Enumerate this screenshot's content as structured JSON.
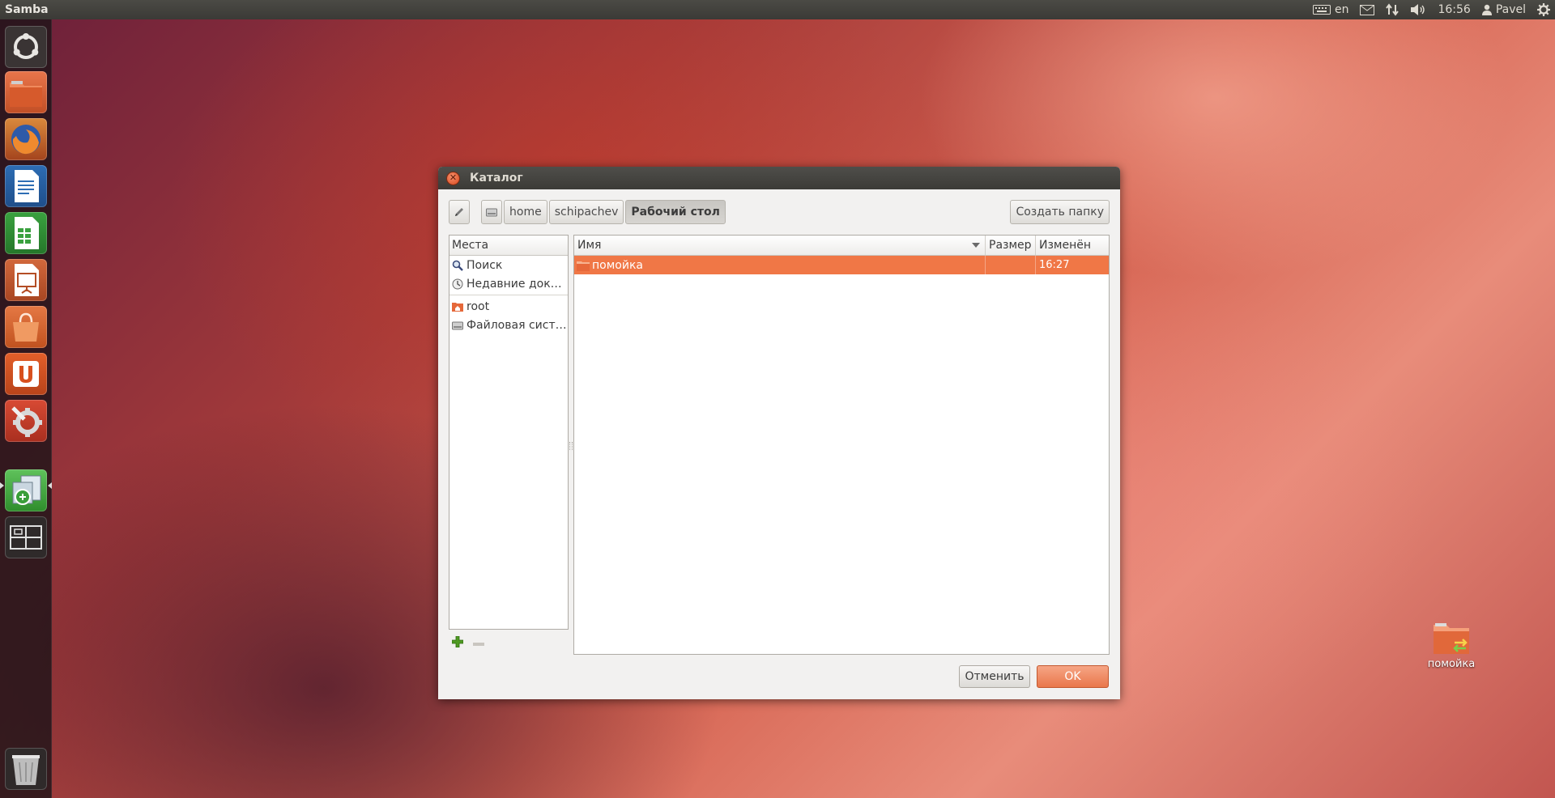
{
  "top_panel": {
    "app_title": "Samba",
    "keyboard_layout": "en",
    "clock": "16:56",
    "user": "Pavel",
    "icons": [
      "keyboard-icon",
      "mail-icon",
      "network-icon",
      "volume-icon",
      "user-icon",
      "gear-icon"
    ]
  },
  "launcher": {
    "items": [
      "ubuntu-dash-icon",
      "files-icon",
      "firefox-icon",
      "writer-icon",
      "calc-icon",
      "impress-icon",
      "software-center-icon",
      "ubuntu-one-icon",
      "system-settings-icon",
      "samba-app-icon",
      "workspaces-icon",
      "trash-icon"
    ]
  },
  "dialog": {
    "title": "Каталог",
    "path_buttons": [
      "home",
      "schipachev",
      "Рабочий стол"
    ],
    "create_folder": "Создать папку",
    "places": {
      "header": "Места",
      "items": [
        "Поиск",
        "Недавние доку…",
        "root",
        "Файловая сист…"
      ]
    },
    "files": {
      "columns": [
        "Имя",
        "Размер",
        "Изменён"
      ],
      "rows": [
        {
          "name": "помойка",
          "size": "",
          "modified": "16:27"
        }
      ]
    },
    "cancel": "Отменить",
    "ok": "OK"
  },
  "desktop": {
    "folder_label": "помойка"
  },
  "colors": {
    "accent": "#f07746",
    "panel": "#3c3b37"
  }
}
